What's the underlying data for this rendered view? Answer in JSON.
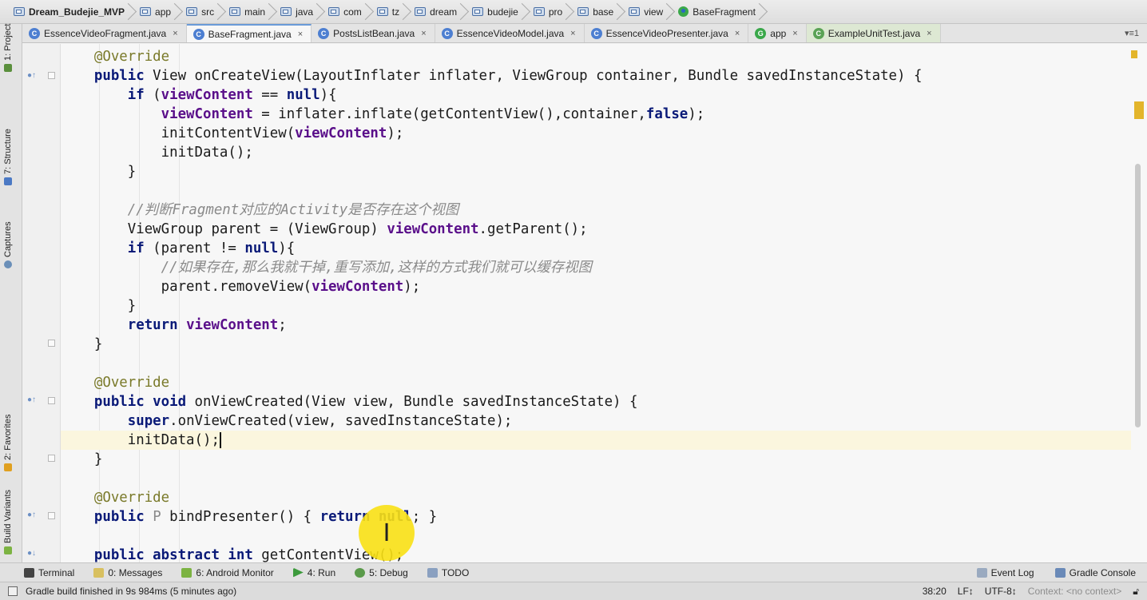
{
  "breadcrumb": [
    "Dream_Budejie_MVP",
    "app",
    "src",
    "main",
    "java",
    "com",
    "tz",
    "dream",
    "budejie",
    "pro",
    "base",
    "view",
    "BaseFragment"
  ],
  "tabs": [
    {
      "label": "EssenceVideoFragment.java",
      "icon": "C",
      "close": "×"
    },
    {
      "label": "BaseFragment.java",
      "icon": "C",
      "close": "×"
    },
    {
      "label": "PostsListBean.java",
      "icon": "C",
      "close": "×"
    },
    {
      "label": "EssenceVideoModel.java",
      "icon": "C",
      "close": "×"
    },
    {
      "label": "EssenceVideoPresenter.java",
      "icon": "C",
      "close": "×"
    },
    {
      "label": "app",
      "icon": "G",
      "close": "×"
    },
    {
      "label": "ExampleUnitTest.java",
      "icon": "C",
      "close": "×"
    }
  ],
  "tab_menu": "▾≡1",
  "left_tools": [
    "1: Project",
    "7: Structure",
    "Captures",
    "2: Favorites",
    "Build Variants"
  ],
  "code_lines": [
    [
      [
        "ann",
        "    @Override"
      ]
    ],
    [
      [
        "kw",
        "    public"
      ],
      [
        "",
        " View onCreateView(LayoutInflater inflater, ViewGroup container, Bundle savedInstanceState) {"
      ]
    ],
    [
      [
        "kw",
        "        if"
      ],
      [
        "",
        " ("
      ],
      [
        "field",
        "viewContent"
      ],
      [
        "",
        " == "
      ],
      [
        "kw",
        "null"
      ],
      [
        "",
        "){"
      ]
    ],
    [
      [
        "field",
        "            viewContent"
      ],
      [
        "",
        " = inflater.inflate(getContentView(),container,"
      ],
      [
        "kw",
        "false"
      ],
      [
        "",
        ");"
      ]
    ],
    [
      [
        "",
        "            initContentView("
      ],
      [
        "field",
        "viewContent"
      ],
      [
        "",
        ");"
      ]
    ],
    [
      [
        "",
        "            initData();"
      ]
    ],
    [
      [
        "",
        "        }"
      ]
    ],
    [
      [
        "",
        ""
      ]
    ],
    [
      [
        "cmt",
        "        //判断Fragment对应的Activity是否存在这个视图"
      ]
    ],
    [
      [
        "",
        "        ViewGroup parent = (ViewGroup) "
      ],
      [
        "field",
        "viewContent"
      ],
      [
        "",
        ".getParent();"
      ]
    ],
    [
      [
        "kw",
        "        if"
      ],
      [
        "",
        " (parent != "
      ],
      [
        "kw",
        "null"
      ],
      [
        "",
        "){"
      ]
    ],
    [
      [
        "cmt",
        "            //如果存在,那么我就干掉,重写添加,这样的方式我们就可以缓存视图"
      ]
    ],
    [
      [
        "",
        "            parent.removeView("
      ],
      [
        "field",
        "viewContent"
      ],
      [
        "",
        ");"
      ]
    ],
    [
      [
        "",
        "        }"
      ]
    ],
    [
      [
        "kw",
        "        return"
      ],
      [
        "",
        " "
      ],
      [
        "field",
        "viewContent"
      ],
      [
        "",
        ";"
      ]
    ],
    [
      [
        "",
        "    }"
      ]
    ],
    [
      [
        "",
        ""
      ]
    ],
    [
      [
        "ann",
        "    @Override"
      ]
    ],
    [
      [
        "kw",
        "    public void"
      ],
      [
        "",
        " onViewCreated(View view, Bundle savedInstanceState) {"
      ]
    ],
    [
      [
        "kw",
        "        super"
      ],
      [
        "",
        ".onViewCreated(view, savedInstanceState);"
      ]
    ],
    [
      [
        "",
        "        initData();"
      ]
    ],
    [
      [
        "",
        "    }"
      ]
    ],
    [
      [
        "",
        ""
      ]
    ],
    [
      [
        "ann",
        "    @Override"
      ]
    ],
    [
      [
        "kw",
        "    public"
      ],
      [
        "",
        " "
      ],
      [
        "tp",
        "P"
      ],
      [
        "",
        " bindPresenter() { "
      ],
      [
        "kw",
        "return null"
      ],
      [
        "",
        "; }"
      ]
    ],
    [
      [
        "",
        ""
      ]
    ],
    [
      [
        "kw",
        "    public abstract int"
      ],
      [
        "",
        " getContentView();"
      ]
    ]
  ],
  "bottom_tools_left": [
    "Terminal",
    "0: Messages",
    "6: Android Monitor",
    "4: Run",
    "5: Debug",
    "TODO"
  ],
  "bottom_tools_right": [
    "Event Log",
    "Gradle Console"
  ],
  "status": {
    "message": "Gradle build finished in 9s 984ms (5 minutes ago)",
    "position": "38:20",
    "line_sep": "LF↕",
    "encoding": "UTF-8↕",
    "context": "Context: <no context>"
  },
  "colors": {
    "keyword": "#0a1a78",
    "field": "#5a0f8a",
    "annotation": "#7a7a2a",
    "comment": "#8a8a8a",
    "current_line": "#fbf6de",
    "click_indicator": "#f8e014"
  }
}
